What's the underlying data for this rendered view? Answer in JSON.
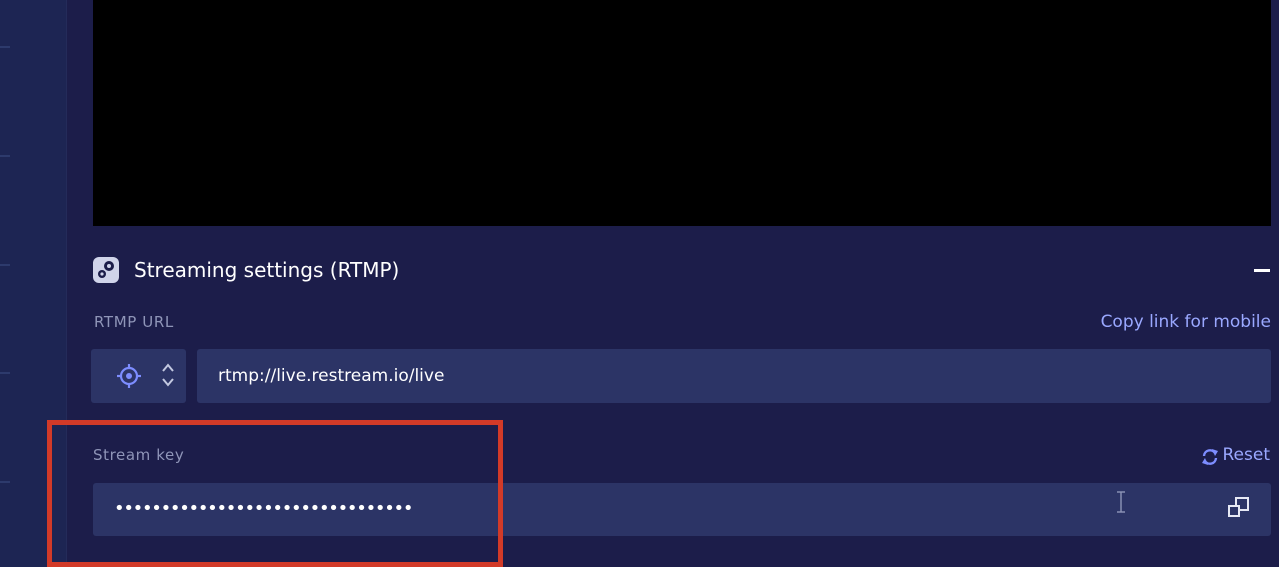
{
  "streaming_settings": {
    "title": "Streaming settings (RTMP)",
    "collapse_icon": "minus-icon"
  },
  "rtmp": {
    "label": "RTMP URL",
    "copy_link_label": "Copy link for mobile",
    "url_value": "rtmp://live.restream.io/live",
    "server_icon": "target-icon",
    "selector_icon": "updown-chevron-icon"
  },
  "stream_key": {
    "label": "Stream key",
    "reset_label": "Reset",
    "reset_icon": "refresh-icon",
    "masked_value": "••••••••••••••••••••••••••••••••",
    "copy_icon": "copy-icon"
  },
  "colors": {
    "background": "#1c1d4a",
    "field": "#2c3466",
    "link": "#9aa8ff",
    "highlight": "#d23a28",
    "preview": "#000000"
  }
}
